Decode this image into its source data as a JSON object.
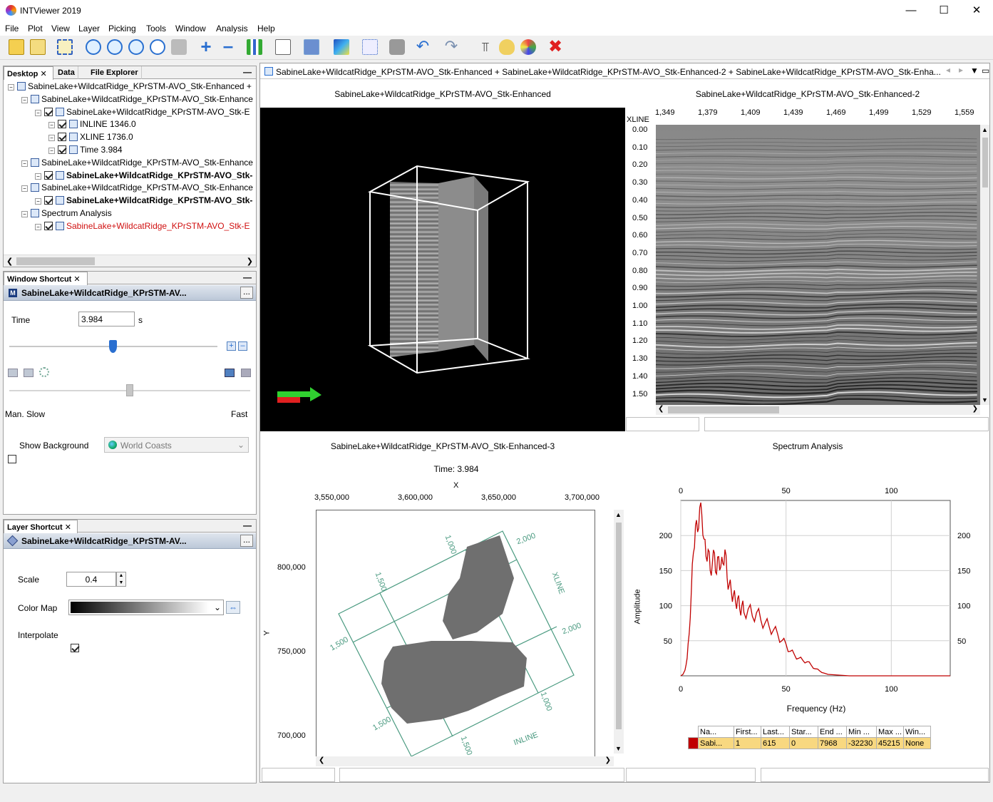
{
  "app": {
    "title": "INTViewer 2019"
  },
  "menu": [
    "File",
    "Plot",
    "View",
    "Layer",
    "Picking",
    "Tools",
    "Window",
    "Analysis",
    "Help"
  ],
  "left_tabs": {
    "desktop": "Desktop",
    "data": "Data",
    "file_explorer": "File Explorer"
  },
  "tree": [
    {
      "label": "SabineLake+WildcatRidge_KPrSTM-AVO_Stk-Enhanced +",
      "level": 0,
      "check": false
    },
    {
      "label": "SabineLake+WildcatRidge_KPrSTM-AVO_Stk-Enhance",
      "level": 1,
      "check": false
    },
    {
      "label": "SabineLake+WildcatRidge_KPrSTM-AVO_Stk-E",
      "level": 2,
      "check": true
    },
    {
      "label": "INLINE 1346.0",
      "level": 3,
      "check": true
    },
    {
      "label": "XLINE 1736.0",
      "level": 3,
      "check": true
    },
    {
      "label": "Time 3.984",
      "level": 3,
      "check": true
    },
    {
      "label": "SabineLake+WildcatRidge_KPrSTM-AVO_Stk-Enhance",
      "level": 1,
      "check": false
    },
    {
      "label": "SabineLake+WildcatRidge_KPrSTM-AVO_Stk-",
      "level": 2,
      "check": true,
      "bold": true
    },
    {
      "label": "SabineLake+WildcatRidge_KPrSTM-AVO_Stk-Enhance",
      "level": 1,
      "check": false
    },
    {
      "label": "SabineLake+WildcatRidge_KPrSTM-AVO_Stk-",
      "level": 2,
      "check": true,
      "bold": true
    },
    {
      "label": "Spectrum Analysis",
      "level": 1,
      "check": false
    },
    {
      "label": "SabineLake+WildcatRidge_KPrSTM-AVO_Stk-E",
      "level": 2,
      "check": true,
      "red": true
    }
  ],
  "window_shortcut": {
    "tab": "Window Shortcut",
    "header": "SabineLake+WildcatRidge_KPrSTM-AV...",
    "time_label": "Time",
    "time_value": "3.984",
    "time_unit": "s",
    "slow_label": "Man.  Slow",
    "fast_label": "Fast",
    "show_background": "Show Background",
    "bg_value": "World Coasts"
  },
  "layer_shortcut": {
    "tab": "Layer Shortcut",
    "header": "SabineLake+WildcatRidge_KPrSTM-AV...",
    "scale_label": "Scale",
    "scale_value": "0.4",
    "colormap_label": "Color Map",
    "interpolate_label": "Interpolate"
  },
  "doc_tab": "SabineLake+WildcatRidge_KPrSTM-AVO_Stk-Enhanced + SabineLake+WildcatRidge_KPrSTM-AVO_Stk-Enhanced-2 + SabineLake+WildcatRidge_KPrSTM-AVO_Stk-Enha...",
  "plots": {
    "p3d_title": "SabineLake+WildcatRidge_KPrSTM-AVO_Stk-Enhanced",
    "section_title": "SabineLake+WildcatRidge_KPrSTM-AVO_Stk-Enhanced-2",
    "section_xaxis_label": "XLINE",
    "section_xticks": [
      "1,349",
      "1,379",
      "1,409",
      "1,439",
      "1,469",
      "1,499",
      "1,529",
      "1,559"
    ],
    "section_yticks": [
      "0.00",
      "0.10",
      "0.20",
      "0.30",
      "0.40",
      "0.50",
      "0.60",
      "0.70",
      "0.80",
      "0.90",
      "1.00",
      "1.10",
      "1.20",
      "1.30",
      "1.40",
      "1.50"
    ],
    "map_title": "SabineLake+WildcatRidge_KPrSTM-AVO_Stk-Enhanced-3",
    "map_subtitle": "Time: 3.984",
    "map_xlabel": "X",
    "map_ylabel": "Y",
    "map_xticks": [
      "3,550,000",
      "3,600,000",
      "3,650,000",
      "3,700,000"
    ],
    "map_yticks": [
      "800,000",
      "750,000",
      "700,000"
    ],
    "map_grid_labels": [
      "1,000",
      "2,000",
      "1,500",
      "XLINE",
      "1,500",
      "2,000",
      "1,000",
      "1,500",
      "1,500",
      "INLINE"
    ]
  },
  "chart_data": {
    "type": "line",
    "title": "Spectrum Analysis",
    "xlabel": "Frequency (Hz)",
    "ylabel": "Amplitude",
    "xlim": [
      0,
      128
    ],
    "ylim": [
      0,
      250
    ],
    "xticks": [
      "0",
      "50",
      "100"
    ],
    "yticks": [
      "50",
      "100",
      "150",
      "200"
    ],
    "series": [
      {
        "color": "#c00000",
        "x": [
          0,
          1,
          2,
          3,
          4,
          5,
          6,
          7,
          8,
          9,
          10,
          11,
          12,
          13,
          14,
          15,
          16,
          17,
          18,
          19,
          20,
          21,
          22,
          23,
          24,
          25,
          26,
          27,
          28,
          29,
          30,
          32,
          34,
          36,
          38,
          40,
          42,
          44,
          46,
          48,
          50,
          52,
          54,
          56,
          58,
          60,
          62,
          64,
          66,
          68,
          70,
          75,
          80,
          90,
          100,
          110,
          120,
          128
        ],
        "y": [
          0,
          2,
          8,
          25,
          60,
          120,
          175,
          215,
          205,
          240,
          230,
          195,
          170,
          180,
          150,
          160,
          175,
          145,
          170,
          155,
          160,
          180,
          140,
          130,
          120,
          115,
          105,
          110,
          95,
          100,
          90,
          95,
          85,
          90,
          80,
          75,
          70,
          65,
          60,
          50,
          45,
          35,
          30,
          25,
          22,
          20,
          15,
          10,
          7,
          4,
          2,
          1,
          0,
          0,
          0,
          0,
          0,
          0
        ]
      }
    ]
  },
  "spectrum_table": {
    "headers": [
      "Na...",
      "First...",
      "Last...",
      "Star...",
      "End ...",
      "Min ...",
      "Max ...",
      "Win..."
    ],
    "row": [
      "Sabi...",
      "1",
      "615",
      "0",
      "7968",
      "-32230",
      "45215",
      "None"
    ]
  }
}
